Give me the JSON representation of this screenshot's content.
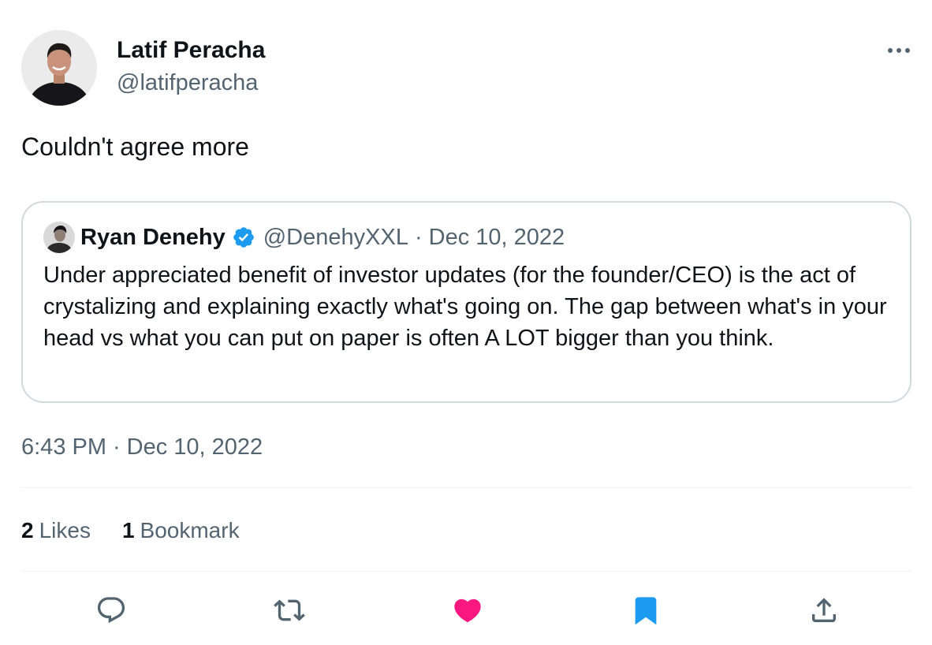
{
  "tweet": {
    "author_name": "Latif Peracha",
    "author_handle": "@latifperacha",
    "text": "Couldn't agree more",
    "time": "6:43 PM",
    "date": "Dec 10, 2022",
    "separator": "·"
  },
  "quote": {
    "author_name": "Ryan Denehy",
    "author_handle": "@DenehyXXL",
    "separator": "·",
    "date": "Dec 10, 2022",
    "text": "Under appreciated benefit of investor updates (for the founder/CEO) is the act of crystalizing and explaining exactly what's going on. The gap between what's in your head vs what you can put on paper is often A LOT bigger than you think."
  },
  "stats": {
    "likes_count": "2",
    "likes_label": "Likes",
    "bookmarks_count": "1",
    "bookmarks_label": "Bookmark"
  },
  "icons": {
    "more": "more-horizontal-icon",
    "verified": "verified-badge-icon",
    "reply": "reply-icon",
    "retweet": "retweet-icon",
    "like": "heart-icon",
    "bookmark": "bookmark-icon",
    "share": "share-icon"
  },
  "colors": {
    "text_primary": "#0f1419",
    "text_secondary": "#536471",
    "verified_blue": "#1d9bf0",
    "like_pink": "#f91880",
    "bookmark_blue": "#1d9bf0",
    "border": "#cfd9de"
  }
}
